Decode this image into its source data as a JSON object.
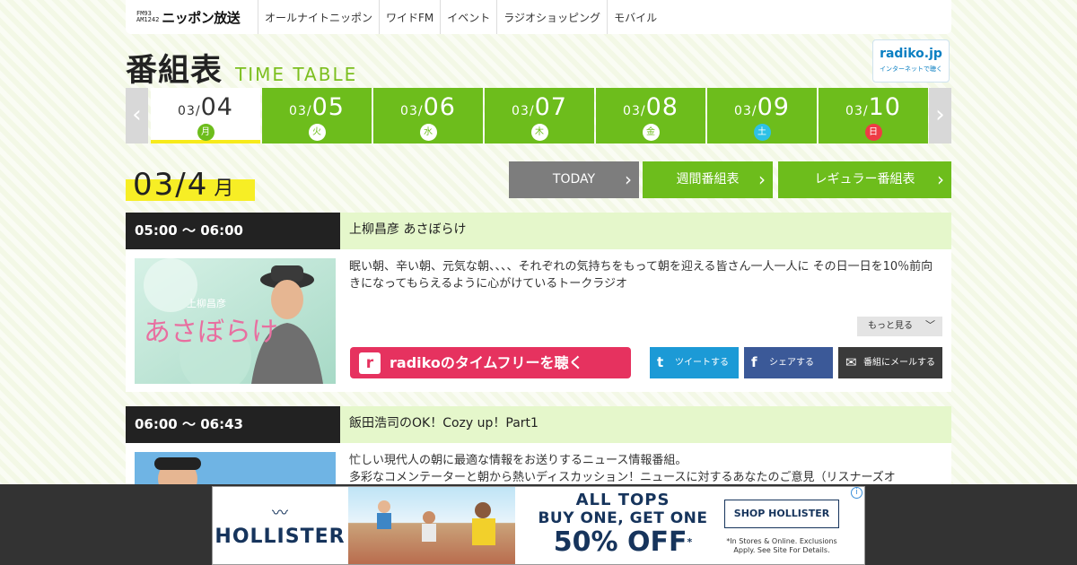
{
  "header": {
    "logo": {
      "mark_top": "FM93",
      "mark_bottom": "AM1242",
      "name": "ニッポン放送"
    },
    "nav": [
      "オールナイトニッポン",
      "ワイドFM",
      "イベント",
      "ラジオショッピング",
      "モバイル"
    ]
  },
  "page": {
    "title": "番組表",
    "subtitle": "TIME TABLE",
    "radiko_badge": {
      "logo": "radiko.jp",
      "caption": "インターネットで聴く"
    }
  },
  "date_tabs": {
    "prev_icon": "chevron-left-icon",
    "next_icon": "chevron-right-icon",
    "prev_glyph": "‹",
    "next_glyph": "›",
    "active_index": 0,
    "items": [
      {
        "month": "03/",
        "day": "04",
        "weekday": "月",
        "kind": "weekday"
      },
      {
        "month": "03/",
        "day": "05",
        "weekday": "火",
        "kind": "weekday"
      },
      {
        "month": "03/",
        "day": "06",
        "weekday": "水",
        "kind": "weekday"
      },
      {
        "month": "03/",
        "day": "07",
        "weekday": "木",
        "kind": "weekday"
      },
      {
        "month": "03/",
        "day": "08",
        "weekday": "金",
        "kind": "weekday"
      },
      {
        "month": "03/",
        "day": "09",
        "weekday": "土",
        "kind": "saturday"
      },
      {
        "month": "03/",
        "day": "10",
        "weekday": "日",
        "kind": "sunday"
      }
    ]
  },
  "current_date": {
    "date": "03/4",
    "weekday": "月"
  },
  "buttons": {
    "today": "TODAY",
    "weekly": "週間番組表",
    "regular": "レギュラー番組表",
    "chevron": "›"
  },
  "programs": [
    {
      "time": "05:00 ～ 06:00",
      "title": "上柳昌彦 あさぼらけ",
      "thumb_text": "あさぼらけ",
      "thumb_sub": "上柳昌彦",
      "description": "眠い朝、辛い朝、元気な朝、、、、それぞれの気持ちをもって朝を迎える皆さん一人一人に その日一日を10％前向きになってもらえるように心がけているトークラジオ",
      "more_label": "もっと見る",
      "more_glyph": "﹀",
      "radiko_label": "radikoのタイムフリーを聴く",
      "radiko_glyph": "r",
      "share": {
        "tweet": "ツイートする",
        "facebook": "シェアする",
        "mail": "番組にメールする",
        "tw_glyph": "t",
        "fb_glyph": "f",
        "mail_glyph": "✉"
      }
    },
    {
      "time": "06:00 ～ 06:43",
      "title": "飯田浩司のOK！Cozy up！Part1",
      "description": "忙しい現代人の朝に最適な情報をお送りするニュース情報番組。\n多彩なコメンテーターと朝から熱いディスカッション！ニュースに対するあなたのご意見（リスナーズオ"
    }
  ],
  "ad": {
    "brand": "HOLLISTER",
    "brand_glyph": "〰",
    "line1": "ALL TOPS",
    "line2": "BUY ONE, GET ONE",
    "line3": "50% OFF",
    "line3_mark": "*",
    "cta": "SHOP HOLLISTER",
    "fine_print": "*In Stores & Online. Exclusions Apply. See Site For Details.",
    "info_glyph": "i"
  },
  "colors": {
    "green": "#6dbd1c",
    "yellow": "#f7ea1a",
    "dark": "#222222",
    "light_green": "#e5f7cb",
    "radiko_pink": "#e6325f",
    "twitter": "#1c9ad6",
    "facebook": "#3b5998"
  }
}
